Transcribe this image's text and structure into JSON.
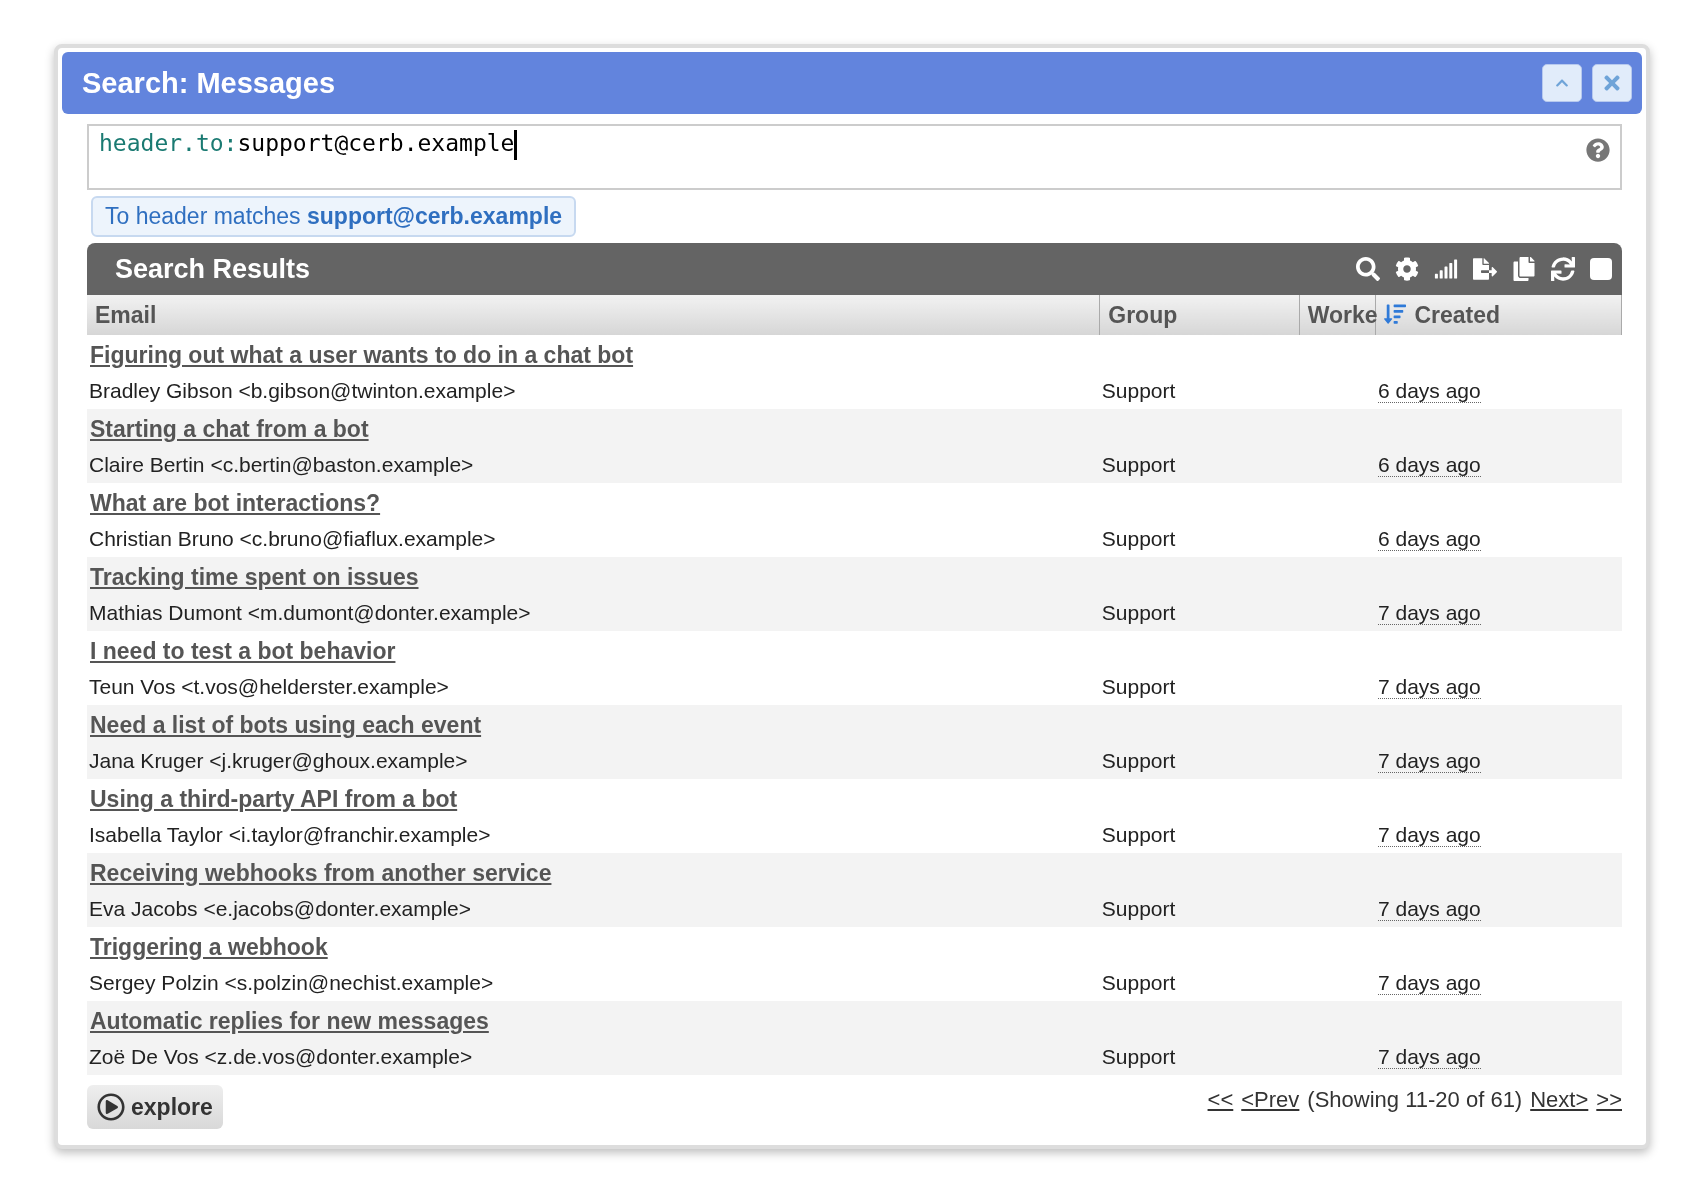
{
  "window": {
    "title": "Search: Messages"
  },
  "query": {
    "field": "header.to:",
    "value": "support@cerb.example"
  },
  "filter_chip": {
    "label": "To header matches ",
    "value": "support@cerb.example"
  },
  "results": {
    "title": "Search Results",
    "select_all": {
      "checked": false
    },
    "columns": [
      {
        "label": "Email",
        "sorted": false
      },
      {
        "label": "Group",
        "sorted": false
      },
      {
        "label": "Worke",
        "sorted": false
      },
      {
        "label": "Created",
        "sorted": true
      }
    ],
    "rows": [
      {
        "subject": "Figuring out what a user wants to do in a chat bot",
        "sender": "Bradley Gibson <b.gibson@twinton.example>",
        "group": "Support",
        "created": "6 days ago"
      },
      {
        "subject": "Starting a chat from a bot",
        "sender": "Claire Bertin <c.bertin@baston.example>",
        "group": "Support",
        "created": "6 days ago"
      },
      {
        "subject": "What are bot interactions?",
        "sender": "Christian Bruno <c.bruno@fiaflux.example>",
        "group": "Support",
        "created": "6 days ago"
      },
      {
        "subject": "Tracking time spent on issues",
        "sender": "Mathias Dumont <m.dumont@donter.example>",
        "group": "Support",
        "created": "7 days ago"
      },
      {
        "subject": "I need to test a bot behavior",
        "sender": "Teun Vos <t.vos@helderster.example>",
        "group": "Support",
        "created": "7 days ago"
      },
      {
        "subject": "Need a list of bots using each event",
        "sender": "Jana Kruger <j.kruger@ghoux.example>",
        "group": "Support",
        "created": "7 days ago"
      },
      {
        "subject": "Using a third-party API from a bot",
        "sender": "Isabella Taylor <i.taylor@franchir.example>",
        "group": "Support",
        "created": "7 days ago"
      },
      {
        "subject": "Receiving webhooks from another service",
        "sender": "Eva Jacobs <e.jacobs@donter.example>",
        "group": "Support",
        "created": "7 days ago"
      },
      {
        "subject": "Triggering a webhook",
        "sender": "Sergey Polzin <s.polzin@nechist.example>",
        "group": "Support",
        "created": "7 days ago"
      },
      {
        "subject": "Automatic replies for new messages",
        "sender": "Zoë De Vos <z.de.vos@donter.example>",
        "group": "Support",
        "created": "7 days ago"
      }
    ]
  },
  "explore_button": {
    "label": "explore"
  },
  "pagination": {
    "first": "<<",
    "prev": "<Prev",
    "status": "(Showing 11-20 of 61)",
    "next": "Next>",
    "last": ">>"
  }
}
